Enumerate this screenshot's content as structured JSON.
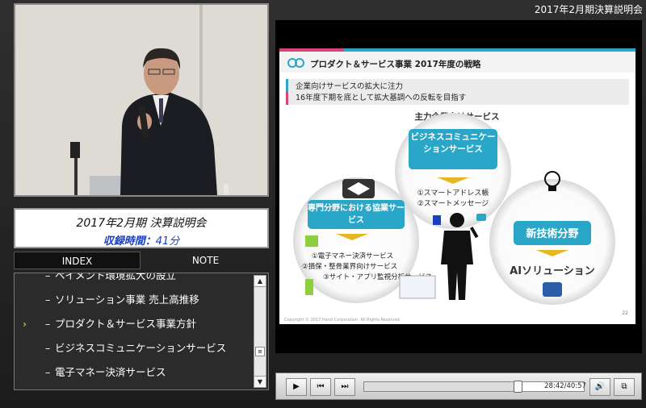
{
  "window": {
    "title": "2017年2月期決算説明会"
  },
  "info": {
    "title": "2017年2月期 決算説明会",
    "duration_label": "収録時間：",
    "duration_value": "41分"
  },
  "tabs": {
    "index": "INDEX",
    "note": "NOTE"
  },
  "index_items": [
    {
      "label": "ペイメント環境拡大の設立",
      "active": false
    },
    {
      "label": "ソリューション事業 売上高推移",
      "active": false
    },
    {
      "label": "プロダクト＆サービス事業方針",
      "active": true
    },
    {
      "label": "ビジネスコミュニケーションサービス",
      "active": false
    },
    {
      "label": "電子マネー決済サービス",
      "active": false
    }
  ],
  "index_marker": "–",
  "active_marker": "›",
  "slide": {
    "header": "プロダクト＆サービス事業 2017年度の戦略",
    "line1": "企業向けサービスの拡大に注力",
    "line2": "16年度下期を底として拡大基調への反転を目指す",
    "main_label": "主力企業向けサービス",
    "circle_top_title": "ビジネスコミュニケーションサービス",
    "circle_top_items": [
      "①スマートアドレス帳",
      "②スマートメッセージ"
    ],
    "circle_left_title": "専門分野における協業サービス",
    "circle_left_items": [
      "①電子マネー決済サービス",
      "②損保・整骨業界向けサービス",
      "③サイト・アプリ監視分析サービス"
    ],
    "circle_right_title": "新技術分野",
    "circle_right_sub": "AIソリューション",
    "page_number": "22",
    "copyright": "Copyright © 2017 Hand Corporation. All Rights Reserved."
  },
  "player": {
    "time": "28:42/40:57",
    "progress": 0.7
  },
  "colors": {
    "accent_blue": "#1a3fbf",
    "slide_teal": "#2aa7c8",
    "slide_pink": "#d8437b",
    "active_arrow": "#8ed43f"
  }
}
